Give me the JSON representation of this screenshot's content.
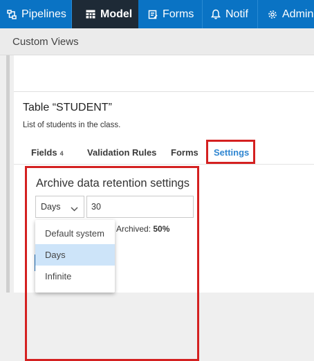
{
  "topnav": {
    "tabs": [
      {
        "label": "Pipelines",
        "icon": "pipelines-icon"
      },
      {
        "label": "Model",
        "icon": "table-icon",
        "active": true
      },
      {
        "label": "Forms",
        "icon": "forms-icon"
      },
      {
        "label": "Notif",
        "icon": "bell-icon"
      },
      {
        "label": "Admin",
        "icon": "gear-icon"
      }
    ]
  },
  "subheader": {
    "title": "Custom Views"
  },
  "table": {
    "title": "Table “STUDENT”",
    "description": "List of students in the class."
  },
  "tabs": {
    "fields_label": "Fields",
    "fields_count": "4",
    "validation_label": "Validation Rules",
    "forms_label": "Forms",
    "settings_label": "Settings"
  },
  "settings": {
    "heading": "Archive data retention settings",
    "unit_selected": "Days",
    "value": "30",
    "archived_label": "Archived:",
    "archived_value": "50%"
  },
  "dropdown": {
    "options": [
      "Default system",
      "Days",
      "Infinite"
    ],
    "selected": "Days"
  },
  "colors": {
    "nav_bg": "#0a73c4",
    "nav_active": "#1e2a36",
    "highlight": "#d42020",
    "link": "#2f86d1",
    "option_selected": "#cde4f9"
  }
}
